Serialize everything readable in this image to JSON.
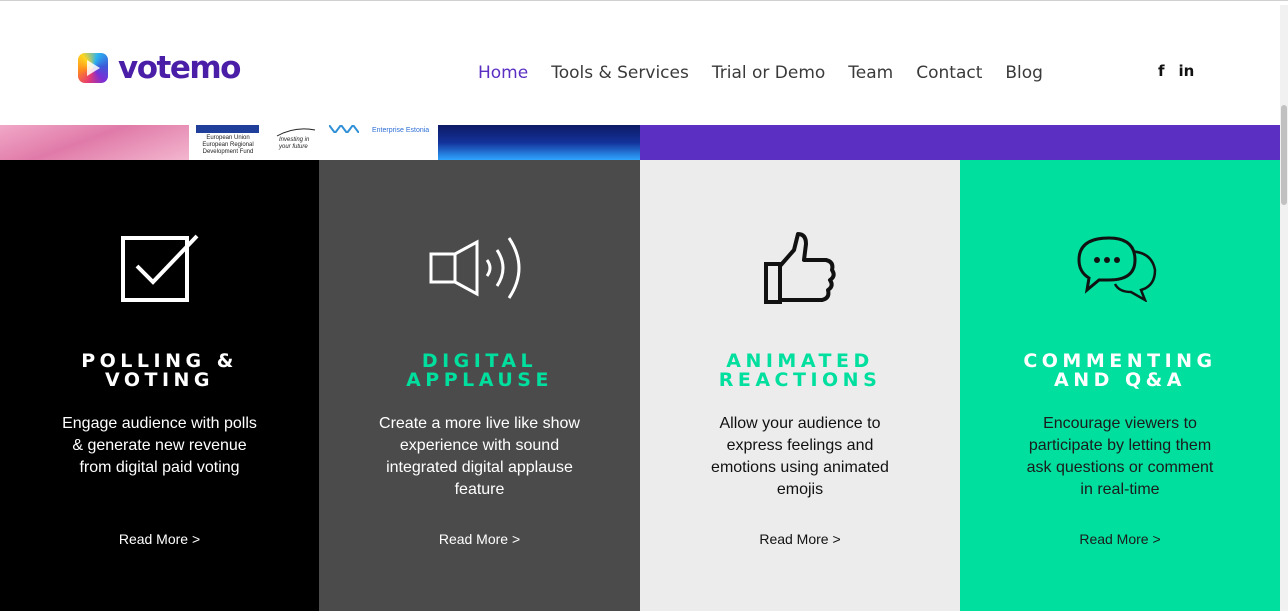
{
  "brand": {
    "name": "votemo",
    "color": "#4b1ea8"
  },
  "nav": {
    "items": [
      "Home",
      "Tools & Services",
      "Trial or Demo",
      "Team",
      "Contact",
      "Blog"
    ],
    "active": "Home",
    "active_color": "#5a2fc2"
  },
  "social": {
    "facebook": "f",
    "linkedin": "in"
  },
  "banner": {
    "eu_text": "European Union European Regional Development Fund",
    "invest_text": "Investing in your future",
    "enterprise_text": "Enterprise Estonia"
  },
  "cards": [
    {
      "icon": "checkbox-icon",
      "title_line1": "POLLING &",
      "title_line2": "VOTING",
      "description": "Engage audience with polls & generate new revenue from digital paid voting",
      "read_more": "Read More >",
      "background": "#000000"
    },
    {
      "icon": "speaker-icon",
      "title_line1": "DIGITAL",
      "title_line2": "APPLAUSE",
      "description": "Create a more live like show experience with sound integrated digital applause feature",
      "read_more": "Read More >",
      "background": "#4b4b4b"
    },
    {
      "icon": "thumbs-up-icon",
      "title_line1": "ANIMATED",
      "title_line2": "REACTIONS",
      "description": "Allow your audience to express feelings and emotions using animated emojis",
      "read_more": "Read More >",
      "background": "#ececec"
    },
    {
      "icon": "chat-bubbles-icon",
      "title_line1": "COMMENTING",
      "title_line2": "AND Q&A",
      "description": "Encourage viewers to participate by letting them ask questions or comment in real-time",
      "read_more": "Read More >",
      "background": "#00df9e"
    }
  ],
  "colors": {
    "accent_green": "#00df9e",
    "purple": "#5a2fc2"
  }
}
